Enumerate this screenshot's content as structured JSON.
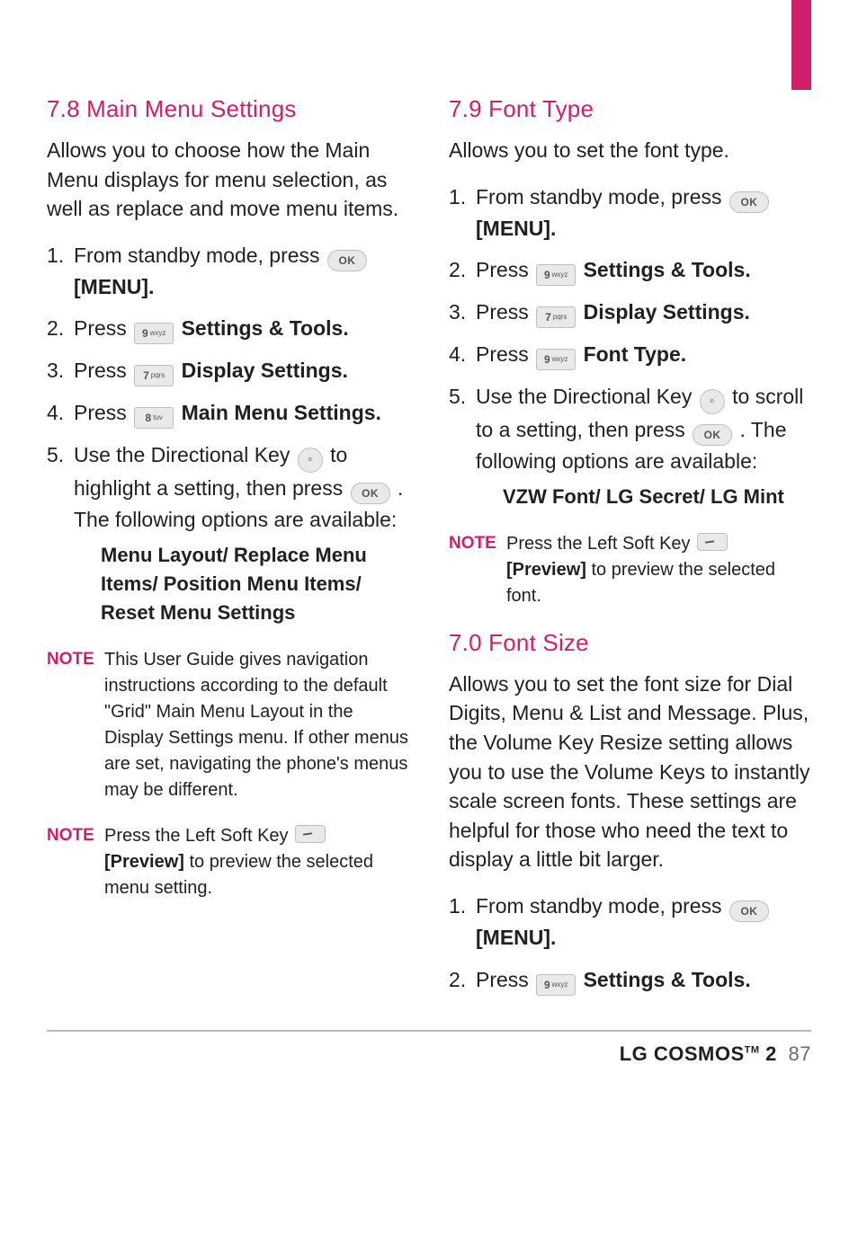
{
  "footer": {
    "brand_prefix": "LG COSMOS",
    "brand_tm": "TM",
    "brand_suffix": " 2",
    "page_number": "87"
  },
  "keys": {
    "ok": "OK",
    "k9": "9",
    "k9sub": "wxyz",
    "k7": "7",
    "k7sub": "pqrs",
    "k8": "8",
    "k8sub": "tuv",
    "dpad": "⟳",
    "softkey": ""
  },
  "left": {
    "h_78": "7.8 Main Menu Settings",
    "p_78": "Allows you to choose how the Main Menu displays for menu selection, as well as replace and move menu items.",
    "s1_a": "From standby mode, press ",
    "s1_b": " [MENU].",
    "s2_a": "Press ",
    "s2_b": " Settings & Tools.",
    "s3_a": "Press ",
    "s3_b": " Display Settings.",
    "s4_a": "Press ",
    "s4_b": " Main Menu Settings.",
    "s5_a": "Use the Directional Key ",
    "s5_b": " to highlight a setting, then press ",
    "s5_c": ". The following options are available:",
    "opts": "Menu Layout/ Replace Menu Items/ Position Menu Items/ Reset Menu Settings",
    "note_label": "NOTE",
    "note1": "This User Guide gives navigation instructions according to the default \"Grid\" Main Menu Layout in the Display Settings menu. If other menus are set, navigating the phone's menus may be different.",
    "note2_a": "Press the Left Soft Key ",
    "note2_b": " [Preview] ",
    "note2_c": "to preview the selected menu setting."
  },
  "right": {
    "h_79": "7.9 Font Type",
    "p_79": "Allows you to set the font type.",
    "s1_a": "From standby mode, press ",
    "s1_b": " [MENU].",
    "s2_a": "Press ",
    "s2_b": " Settings & Tools.",
    "s3_a": "Press ",
    "s3_b": " Display Settings.",
    "s4_a": "Press ",
    "s4_b": " Font Type.",
    "s5_a": "Use the Directional Key ",
    "s5_b": " to scroll to a setting, then press ",
    "s5_c": ". The following options are available:",
    "opts": "VZW Font/ LG Secret/ LG Mint",
    "note_label": "NOTE",
    "note_a": "Press the Left Soft Key ",
    "note_b": " [Preview] ",
    "note_c": "to preview the selected font.",
    "h_70": "7.0 Font Size",
    "p_70": "Allows you to set the font size for Dial Digits, Menu & List and Message.  Plus, the Volume Key Resize setting allows you to use the Volume Keys to instantly scale screen fonts. These settings are helpful for those who need the text to display a little bit larger.",
    "fs_s1_a": "From standby mode, press ",
    "fs_s1_b": " [MENU].",
    "fs_s2_a": "Press ",
    "fs_s2_b": " Settings & Tools."
  }
}
